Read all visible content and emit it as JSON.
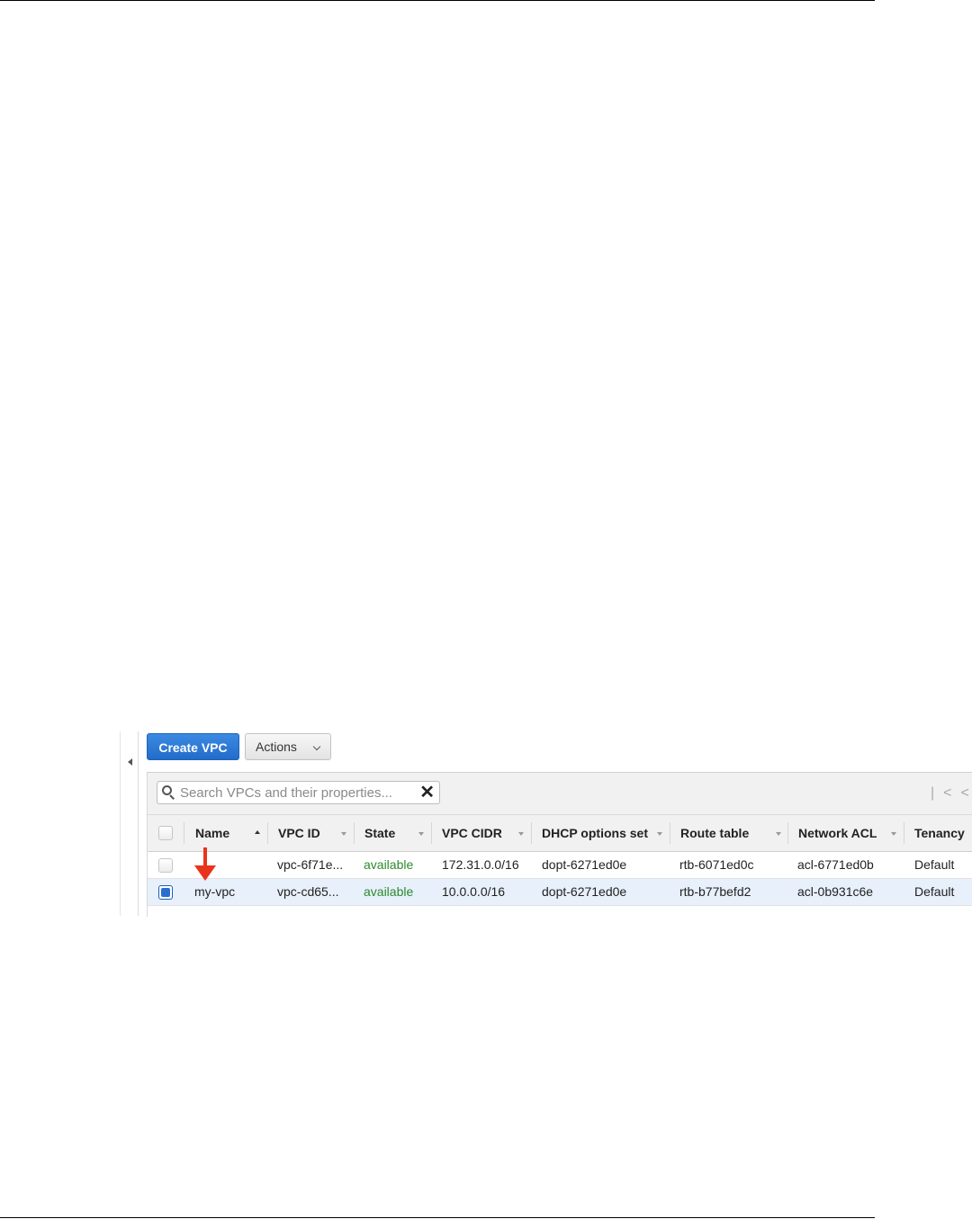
{
  "toolbar": {
    "create_label": "Create VPC",
    "actions_label": "Actions"
  },
  "search": {
    "placeholder": "Search VPCs and their properties..."
  },
  "table": {
    "headers": {
      "name": "Name",
      "vpc_id": "VPC ID",
      "state": "State",
      "cidr": "VPC CIDR",
      "dhcp": "DHCP options set",
      "route": "Route table",
      "acl": "Network ACL",
      "tenancy": "Tenancy"
    },
    "rows": [
      {
        "selected": false,
        "name": "",
        "vpc_id": "vpc-6f71e...",
        "state": "available",
        "cidr": "172.31.0.0/16",
        "dhcp": "dopt-6271ed0e",
        "route": "rtb-6071ed0c",
        "acl": "acl-6771ed0b",
        "tenancy": "Default"
      },
      {
        "selected": true,
        "name": "my-vpc",
        "vpc_id": "vpc-cd65...",
        "state": "available",
        "cidr": "10.0.0.0/16",
        "dhcp": "dopt-6271ed0e",
        "route": "rtb-b77befd2",
        "acl": "acl-0b931c6e",
        "tenancy": "Default"
      }
    ]
  },
  "colors": {
    "primary_button": "#226cc9",
    "available_status": "#2c8a2c",
    "annotation_arrow": "#e8341c",
    "selected_row": "#e7f0fb"
  }
}
